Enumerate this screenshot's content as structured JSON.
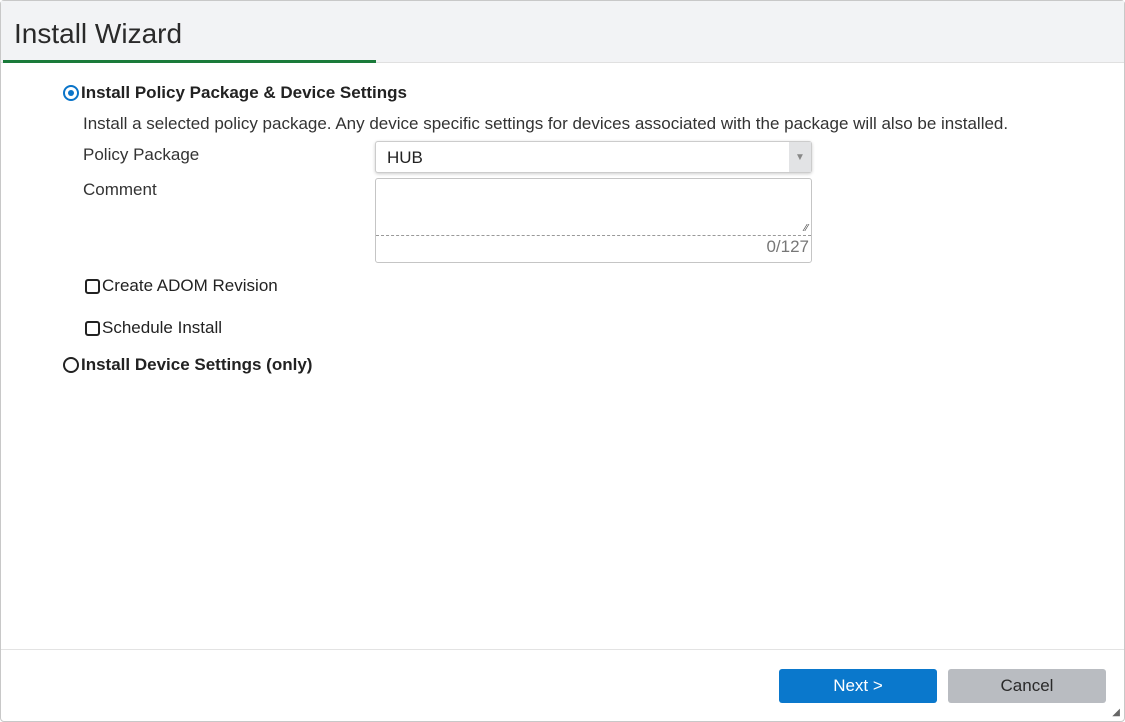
{
  "dialog": {
    "title": "Install Wizard"
  },
  "options": {
    "policy": {
      "label": "Install Policy Package & Device Settings",
      "selected": true,
      "description": "Install a selected policy package. Any device specific settings for devices associated with the package will also be installed.",
      "policy_package_label": "Policy Package",
      "policy_package_value": "HUB",
      "comment_label": "Comment",
      "comment_value": "",
      "comment_counter": "0/127",
      "create_revision_label": "Create ADOM Revision",
      "create_revision_checked": false,
      "schedule_label": "Schedule Install",
      "schedule_checked": false
    },
    "device": {
      "label": "Install Device Settings (only)",
      "selected": false
    }
  },
  "footer": {
    "next_label": "Next >",
    "cancel_label": "Cancel"
  }
}
